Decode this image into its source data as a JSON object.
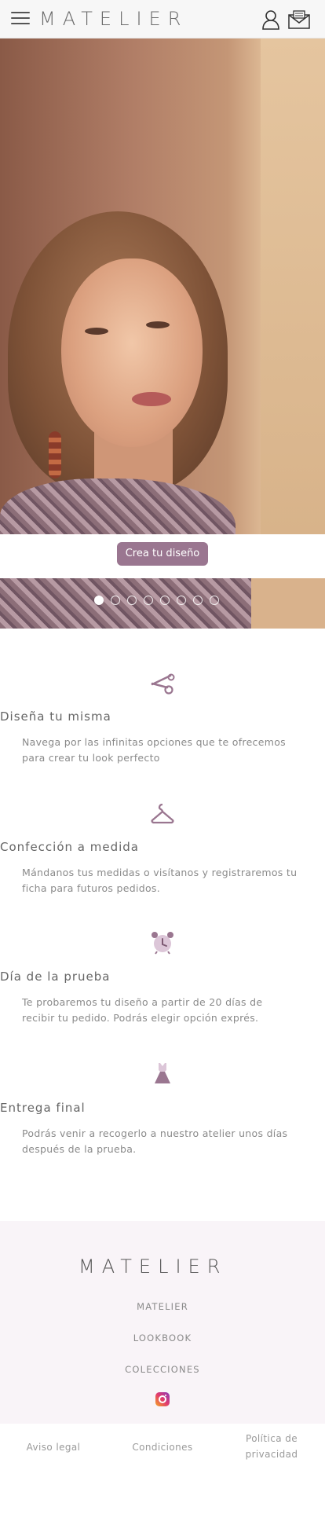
{
  "header": {
    "logo_text": "MATELIER",
    "icons": [
      "menu-icon",
      "user-icon",
      "mail-icon"
    ]
  },
  "hero": {
    "cta_label": "Crea tu diseño",
    "slides_count": 8,
    "active_slide": 1
  },
  "features": [
    {
      "icon": "scissors-icon",
      "title": "Diseña tu misma",
      "desc_line1": "Navega por las infinitas opciones que te ofrecemos",
      "desc_line2": "para crear tu look perfecto"
    },
    {
      "icon": "hanger-icon",
      "title": "Confección a medida",
      "desc_line1": "Mándanos tus medidas o visítanos y registraremos tu",
      "desc_line2": "ficha para futuros pedidos."
    },
    {
      "icon": "alarm-clock-icon",
      "title": "Día de la prueba",
      "desc_line1": "Te probaremos tu diseño a partir de 20 días de",
      "desc_line2": "recibir tu pedido. Podrás elegir opción exprés."
    },
    {
      "icon": "dress-icon",
      "title": "Entrega final",
      "desc_line1": "Podrás venir a recogerlo a nuestro atelier unos días",
      "desc_line2": "después de la prueba."
    }
  ],
  "footer": {
    "logo_text": "MATELIER",
    "links": [
      "MATELIER",
      "LOOKBOOK",
      "COLECCIONES"
    ],
    "social": "instagram-icon"
  },
  "legal": {
    "aviso": "Aviso legal",
    "condiciones": "Condiciones",
    "politica_line1": "Política de",
    "politica_line2": "privacidad"
  },
  "colors": {
    "accent": "#9a7690",
    "footer_bg": "#f9f4f8",
    "icon": "#9a7690"
  }
}
